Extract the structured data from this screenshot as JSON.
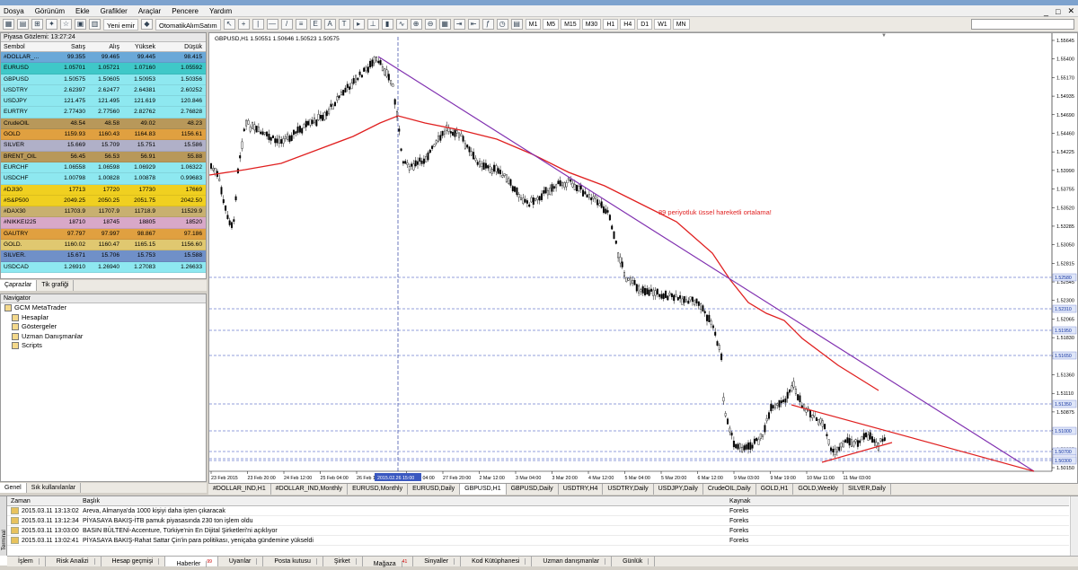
{
  "window": {
    "title": ""
  },
  "menu": [
    "Dosya",
    "Görünüm",
    "Ekle",
    "Grafikler",
    "Araçlar",
    "Pencere",
    "Yardım"
  ],
  "toolbar": {
    "new_order": "Yeni emir",
    "auto_trade": "OtomatikAlımSatım",
    "timeframes": [
      "M1",
      "M5",
      "M15",
      "M30",
      "H1",
      "H4",
      "D1",
      "W1",
      "MN"
    ]
  },
  "market_watch": {
    "title": "Piyasa Gözlemi: 13:27:24",
    "columns": [
      "Sembol",
      "Satış",
      "Alış",
      "Yüksek",
      "Düşük"
    ],
    "rows": [
      {
        "symbol": "#DOLLAR_...",
        "bid": "99.355",
        "ask": "99.465",
        "high": "99.445",
        "low": "98.415",
        "color": "#6aa8d8"
      },
      {
        "symbol": "EURUSD",
        "bid": "1.05701",
        "ask": "1.05721",
        "high": "1.07160",
        "low": "1.05592",
        "color": "#3fc8c8"
      },
      {
        "symbol": "GBPUSD",
        "bid": "1.50575",
        "ask": "1.50605",
        "high": "1.50953",
        "low": "1.50356",
        "color": "#8ee8f0"
      },
      {
        "symbol": "USDTRY",
        "bid": "2.62397",
        "ask": "2.62477",
        "high": "2.64381",
        "low": "2.60252",
        "color": "#8ee8f0"
      },
      {
        "symbol": "USDJPY",
        "bid": "121.475",
        "ask": "121.495",
        "high": "121.619",
        "low": "120.846",
        "color": "#8ee8f0"
      },
      {
        "symbol": "EURTRY",
        "bid": "2.77430",
        "ask": "2.77560",
        "high": "2.82762",
        "low": "2.76828",
        "color": "#8ee8f0"
      },
      {
        "symbol": "CrudeOIL",
        "bid": "48.54",
        "ask": "48.58",
        "high": "49.02",
        "low": "48.23",
        "color": "#b8985a"
      },
      {
        "symbol": "GOLD",
        "bid": "1159.93",
        "ask": "1160.43",
        "high": "1164.83",
        "low": "1156.61",
        "color": "#e0a040"
      },
      {
        "symbol": "SILVER",
        "bid": "15.669",
        "ask": "15.709",
        "high": "15.751",
        "low": "15.586",
        "color": "#b0b0c8"
      },
      {
        "symbol": "BRENT_OIL",
        "bid": "56.45",
        "ask": "56.53",
        "high": "56.91",
        "low": "55.88",
        "color": "#b8985a"
      },
      {
        "symbol": "EURCHF",
        "bid": "1.06558",
        "ask": "1.06598",
        "high": "1.06929",
        "low": "1.06322",
        "color": "#8ee8f0"
      },
      {
        "symbol": "USDCHF",
        "bid": "1.00798",
        "ask": "1.00828",
        "high": "1.00878",
        "low": "0.99683",
        "color": "#8ee8f0"
      },
      {
        "symbol": "#DJI30",
        "bid": "17713",
        "ask": "17720",
        "high": "17730",
        "low": "17669",
        "color": "#f0d020"
      },
      {
        "symbol": "#S&P500",
        "bid": "2049.25",
        "ask": "2050.25",
        "high": "2051.75",
        "low": "2042.50",
        "color": "#f0d020"
      },
      {
        "symbol": "#DAX30",
        "bid": "11703.9",
        "ask": "11707.9",
        "high": "11718.9",
        "low": "11529.9",
        "color": "#c8b070"
      },
      {
        "symbol": "#NIKKEI225",
        "bid": "18710",
        "ask": "18745",
        "high": "18805",
        "low": "18520",
        "color": "#d8a8c8"
      },
      {
        "symbol": "GAUTRY",
        "bid": "97.797",
        "ask": "97.997",
        "high": "98.867",
        "low": "97.186",
        "color": "#e0a040"
      },
      {
        "symbol": "GOLD.",
        "bid": "1160.02",
        "ask": "1160.47",
        "high": "1165.15",
        "low": "1156.60",
        "color": "#e0c870"
      },
      {
        "symbol": "SILVER.",
        "bid": "15.671",
        "ask": "15.706",
        "high": "15.753",
        "low": "15.588",
        "color": "#7090c8"
      },
      {
        "symbol": "USDCAD",
        "bid": "1.26910",
        "ask": "1.26940",
        "high": "1.27083",
        "low": "1.26633",
        "color": "#8ee8f0"
      }
    ],
    "tabs": [
      "Çaprazlar",
      "Tik grafiği"
    ]
  },
  "navigator": {
    "title": "Navigator",
    "items": [
      "GCM MetaTrader",
      "Hesaplar",
      "Göstergeler",
      "Uzman Danışmanlar",
      "Scripts"
    ],
    "tabs": [
      "Genel",
      "Sık kullanılanlar"
    ]
  },
  "chart": {
    "header": "GBPUSD,H1  1.50551 1.50646 1.50523 1.50575",
    "annotation": "89 periyotluk üssel hareketli ortalama!",
    "price_labels": [
      "1.55645",
      "1.55400",
      "1.55170",
      "1.54935",
      "1.54690",
      "1.54460",
      "1.54225",
      "1.53990",
      "1.53755",
      "1.53520",
      "1.53285",
      "1.53050",
      "1.52815",
      "1.52545",
      "1.52300",
      "1.52065",
      "1.51830",
      "1.51595",
      "1.51360",
      "1.51110",
      "1.50875",
      "1.50640",
      "1.50395",
      "1.50150"
    ],
    "highlighted_prices": [
      "1.52580",
      "1.52310",
      "1.51950",
      "1.51650",
      "1.51350",
      "1.51000",
      "1.50700",
      "1.50575",
      "1.50300"
    ],
    "time_labels": [
      "23 Feb 2015",
      "23 Feb 20:00",
      "24 Feb 12:00",
      "25 Feb 04:00",
      "26 Feb 15:00",
      "27 Feb 04:00",
      "27 Feb 20:00",
      "2 Mar 12:00",
      "3 Mar 04:00",
      "3 Mar 20:00",
      "4 Mar 12:00",
      "5 Mar 04:00",
      "5 Mar 20:00",
      "6 Mar 12:00",
      "9 Mar 03:00",
      "9 Mar 19:00",
      "10 Mar 11:00",
      "11 Mar 03:00"
    ],
    "cursor_time": "2015.02.26 15:00",
    "tabs": [
      "#DOLLAR_IND,H1",
      "#DOLLAR_IND,Monthly",
      "EURUSD,Monthly",
      "EURUSD,Daily",
      "GBPUSD,H1",
      "GBPUSD,Daily",
      "USDTRY,H4",
      "USDTRY,Daily",
      "USDJPY,Daily",
      "CrudeOIL,Daily",
      "GOLD,H1",
      "GOLD,Weekly",
      "SILVER,Daily"
    ],
    "active_tab": 4
  },
  "terminal": {
    "columns": [
      "Zaman",
      "Başlık",
      "Kaynak"
    ],
    "rows": [
      {
        "time": "2015.03.11 13:13:02",
        "title": "Areva, Almanya'da 1000 kişiyi daha işten çıkaracak",
        "source": "Foreks"
      },
      {
        "time": "2015.03.11 13:12:34",
        "title": "PİYASAYA BAKIŞ-İTB pamuk piyasasında 230 ton işlem oldu",
        "source": "Foreks"
      },
      {
        "time": "2015.03.11 13:03:00",
        "title": "BASIN BÜLTENİ-Accenture, Türkiye'nin En Dijital Şirketleri'ni açıklıyor",
        "source": "Foreks"
      },
      {
        "time": "2015.03.11 13:02:41",
        "title": "PİYASAYA BAKIŞ-Rahat Sattar Çin'in para politikası, yeniçaba gündemine yükseldi",
        "source": "Foreks"
      }
    ],
    "tabs": [
      "İşlem",
      "Risk Analizi",
      "Hesap geçmişi",
      "Haberler",
      "Uyarılar",
      "Posta kutusu",
      "Şirket",
      "Mağaza",
      "Sinyaller",
      "Kod Kütüphanesi",
      "Uzman danışmanlar",
      "Günlük"
    ],
    "tab_badges": {
      "3": "99",
      "7": "41"
    },
    "active_tab": 3,
    "side_label": "Terminal"
  },
  "colors": {
    "ema": "#e02020",
    "trendline": "#8030b0",
    "candle": "#000000",
    "grid": "#7080d0",
    "triangle": "#e02020"
  }
}
